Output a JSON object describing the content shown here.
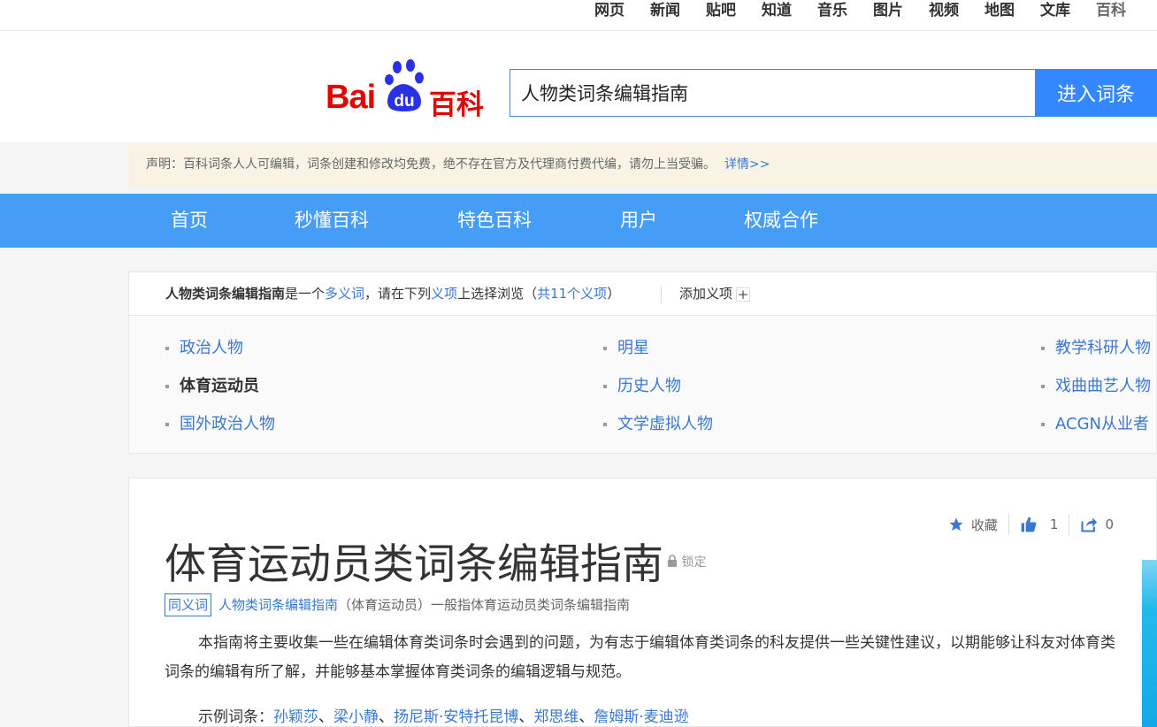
{
  "topnav": [
    "网页",
    "新闻",
    "贴吧",
    "知道",
    "音乐",
    "图片",
    "视频",
    "地图",
    "文库",
    "百科"
  ],
  "logo": {
    "bai": "Bai",
    "du": "du",
    "baike": "百科"
  },
  "search": {
    "value": "人物类词条编辑指南",
    "button": "进入词条"
  },
  "notice": {
    "text": "声明：百科词条人人可编辑，词条创建和修改均免费，绝不存在官方及代理商付费代编，请勿上当受骗。",
    "link": "详情>>"
  },
  "bluenav": [
    "首页",
    "秒懂百科",
    "特色百科",
    "用户",
    "权威合作"
  ],
  "polysemy": {
    "term": "人物类词条编辑指南",
    "is_a": "是一个",
    "polysemy_word": "多义词",
    "please": "，请在下列",
    "sense_word": "义项",
    "choose": "上选择浏览（",
    "count": "共11个义项",
    "close_paren": "）",
    "add": "添加义项",
    "plus": "+",
    "items": [
      "政治人物",
      "明星",
      "教学科研人物",
      "体育运动员",
      "历史人物",
      "戏曲曲艺人物",
      "国外政治人物",
      "文学虚拟人物",
      "ACGN从业者"
    ]
  },
  "article": {
    "title": "体育运动员类词条编辑指南",
    "lock": "锁定",
    "actions": {
      "favorite": "收藏",
      "like_count": "1",
      "share_count": "0"
    },
    "synonym_tag": "同义词",
    "synonym_link": "人物类词条编辑指南",
    "synonym_rest": "（体育运动员）一般指体育运动员类词条编辑指南",
    "paragraph": "本指南将主要收集一些在编辑体育类词条时会遇到的问题，为有志于编辑体育类词条的科友提供一些关键性建议，以期能够让科友对体育类词条的编辑有所了解，并能够基本掌握体育类词条的编辑逻辑与规范。",
    "examples_label": "示例词条：",
    "examples": [
      "孙颖莎",
      "梁小静",
      "扬尼斯·安特托昆博",
      "郑思维",
      "詹姆斯·麦迪逊"
    ],
    "examples_sep": "、"
  },
  "colors": {
    "brand_red": "#e10601",
    "brand_blue": "#2932e1",
    "nav_blue": "#459df5",
    "link_blue": "#3a78d0",
    "button_blue": "#3388ff"
  }
}
